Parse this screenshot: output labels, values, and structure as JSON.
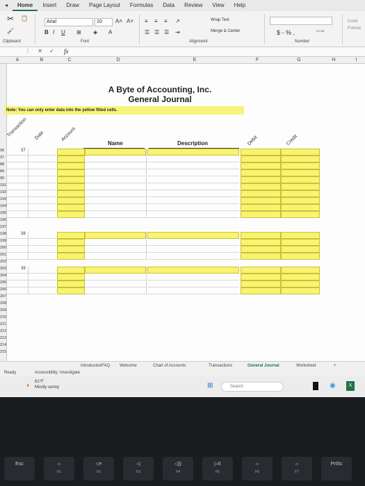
{
  "ribbon_tabs": [
    "Home",
    "Insert",
    "Draw",
    "Page Layout",
    "Formulas",
    "Data",
    "Review",
    "View",
    "Help"
  ],
  "ribbon": {
    "font_name": "Arial",
    "font_size": "10",
    "wrap_text": "Wrap Text",
    "merge_center": "Merge & Center",
    "number_format": "$ - % ,",
    "groups": {
      "clipboard": "Clipboard",
      "font": "Font",
      "alignment": "Alignment",
      "number": "Number"
    },
    "cond_format": "Cond Format"
  },
  "formula_bar": {
    "fx": "fx"
  },
  "columns": [
    "A",
    "B",
    "C",
    "D",
    "E",
    "F",
    "G",
    "H",
    "I"
  ],
  "title": {
    "line1": "A Byte of Accounting, Inc.",
    "line2": "General Journal"
  },
  "note": "Note: You can only enter data into the yellow filled cells.",
  "headers": {
    "transaction": "Transaction",
    "date": "Date",
    "account": "Account",
    "name": "Name",
    "description": "Description",
    "debit": "Debit",
    "credit": "Credit"
  },
  "rows": [
    "36",
    "37",
    "88",
    "89",
    "90",
    "191",
    "192",
    "193",
    "194",
    "195",
    "196",
    "197",
    "198",
    "199",
    "200",
    "201",
    "202",
    "203",
    "204",
    "205",
    "206",
    "207",
    "208",
    "209",
    "210",
    "211",
    "212",
    "213",
    "214",
    "215"
  ],
  "transactions": [
    "37",
    "38",
    "39"
  ],
  "sheet_tabs": [
    "Introduction",
    "FAQ",
    "Welcome",
    "Chart of Accounts",
    "Transactions",
    "General Journal",
    "Worksheet"
  ],
  "active_sheet": "General Journal",
  "status": {
    "ready": "Ready",
    "accessibility": "Accessibility: Investigate"
  },
  "taskbar": {
    "weather_temp": "61°F",
    "weather_desc": "Mostly sunny",
    "search": "Search"
  },
  "keys": [
    {
      "label": "Esc",
      "fn": ""
    },
    {
      "label": "☼",
      "fn": "F1"
    },
    {
      "label": "◁×",
      "fn": "F2"
    },
    {
      "label": "◁",
      "fn": "F3"
    },
    {
      "label": "◁))",
      "fn": "F4"
    },
    {
      "label": "▷II",
      "fn": "F5"
    },
    {
      "label": "☼",
      "fn": "F6"
    },
    {
      "label": "☼",
      "fn": "F7"
    },
    {
      "label": "PrtSc",
      "fn": ""
    }
  ],
  "colors": {
    "yellow": "#f9f36f",
    "accent": "#217346"
  }
}
